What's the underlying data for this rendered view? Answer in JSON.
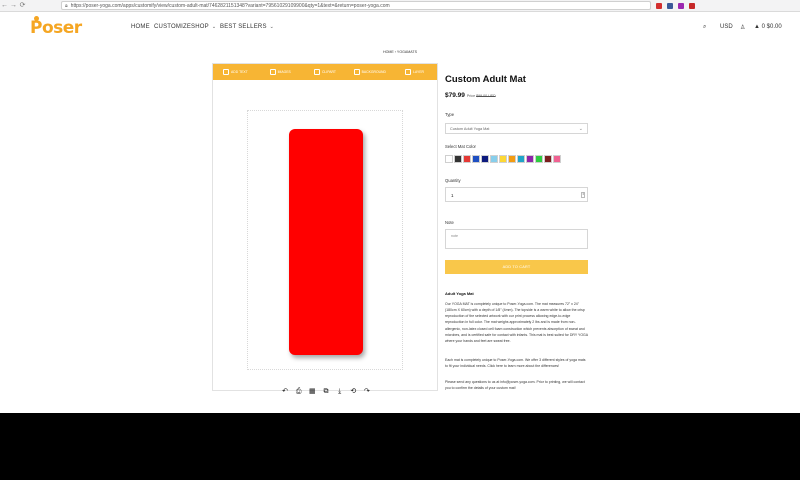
{
  "browser": {
    "url": "https://poser-yoga.com/apps/customify/view/custom-adult-mat/7462821151348?variant=79561029109900&qty=1&text=&return=poser-yoga.com",
    "back_glyph": "←",
    "forward_glyph": "→",
    "reload_glyph": "⟳",
    "extension_colors": [
      "#d32f2f",
      "#3b5998",
      "#9c27b0",
      "#c62828"
    ]
  },
  "header": {
    "logo_text": "Poser",
    "logo_color": "#f5a623",
    "nav": [
      {
        "label": "HOME",
        "dropdown": false
      },
      {
        "label": "CUSTOMIZE",
        "dropdown": false
      },
      {
        "label": "SHOP",
        "dropdown": true
      },
      {
        "label": "BEST SELLERS",
        "dropdown": true
      }
    ],
    "currency": "USD",
    "cart_count": "0",
    "cart_total": "$0.00",
    "icons": [
      "search-icon",
      "user-icon",
      "cart-icon"
    ]
  },
  "breadcrumb": {
    "home": "HOME",
    "separator": "›",
    "current": "YOGAMATS"
  },
  "designer": {
    "accent_color": "#f7b534",
    "tabs": [
      {
        "label": "ADD TEXT",
        "icon": "text-icon"
      },
      {
        "label": "IMAGES",
        "icon": "image-icon"
      },
      {
        "label": "CLIPART",
        "icon": "clipart-icon"
      },
      {
        "label": "BACKGROUND",
        "icon": "background-icon"
      },
      {
        "label": "LAYER",
        "icon": "layer-icon"
      }
    ],
    "mat_color": "#ff0000",
    "bottom_tools": [
      {
        "glyph": "↶",
        "name": "undo-icon"
      },
      {
        "glyph": "⎙",
        "name": "print-icon"
      },
      {
        "glyph": "▦",
        "name": "grid-icon"
      },
      {
        "glyph": "⧉",
        "name": "crop-icon"
      },
      {
        "glyph": "⤓",
        "name": "download-icon"
      },
      {
        "glyph": "⟲",
        "name": "reset-icon"
      },
      {
        "glyph": "↷",
        "name": "redo-icon"
      }
    ]
  },
  "product": {
    "title": "Custom Adult Mat",
    "price": "$79.99",
    "regular_price_label": "Price",
    "regular_price": "$99.00 USD",
    "type_label": "Type",
    "type_value": "Custom Adult Yoga Mat",
    "color_label": "Select Mat Color",
    "swatches": [
      "#ffffff",
      "#333333",
      "#e53935",
      "#1e4fc2",
      "#0d1b7e",
      "#87ceeb",
      "#fdd835",
      "#f39c12",
      "#20a4c9",
      "#8e24aa",
      "#2ecc40",
      "#7b1e1e",
      "#f06292"
    ],
    "quantity_label": "Quantity",
    "quantity_value": "1",
    "note_label": "Note",
    "note_placeholder": "note",
    "add_to_cart": "ADD TO CART",
    "description_title": "Adult Yoga Mat",
    "description": [
      "Our YOGA MAT is completely unique to Poser-Yoga.com. The mat measures 72\" x 24\" (180cm X 60cm) with a depth of 1/8\" (4mm). The topside is a warm white to allow the crisp reproduction of the selected artwork with our print process allowing edge-to-edge reproduction in full color. The mat weighs approximately 2 lbs and is made from non-allergenic, non-latex closed cell foam construction which prevents absorption of sweat and microbes, and is certified safe for contact with infants. This mat is best suited for DRY YOGA where your hands and feet are sweat free.",
      "Each mat is completely unique to Poser-Yoga.com. We offer 3 different styles of yoga mats to fit your individual needs. Click here to learn more about the differences!",
      "Please send any questions to us at info@poser-yoga.com. Prior to printing, we will contact you to confirm the details of your custom mat!"
    ]
  }
}
